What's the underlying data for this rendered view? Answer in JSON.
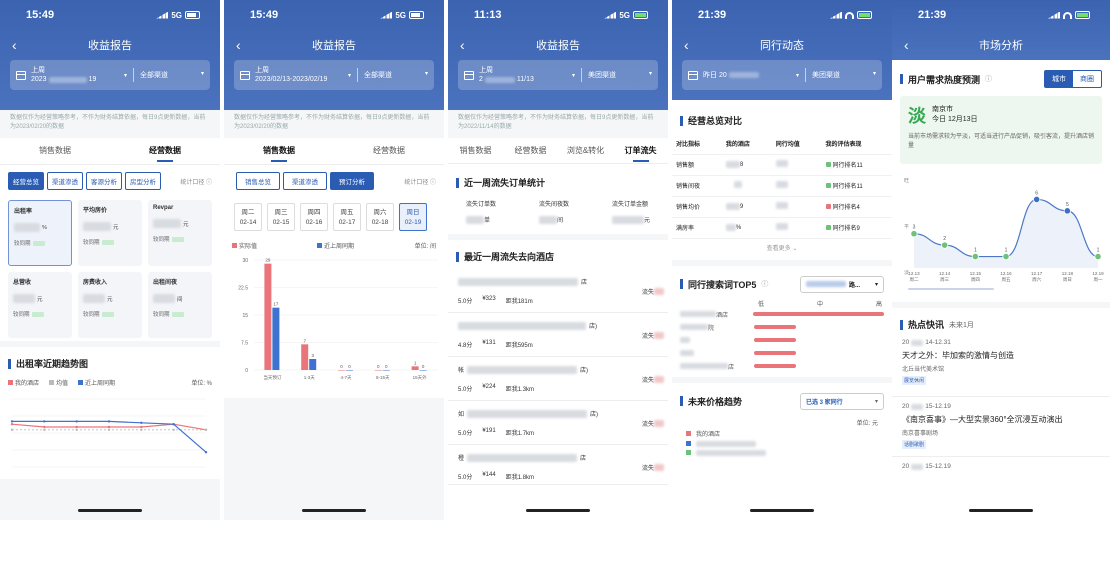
{
  "p1": {
    "time": "15:49",
    "net": "5G",
    "title": "收益报告",
    "date_label": "上周",
    "date_value": "2023",
    "date_end": "19",
    "channel": "全部渠道",
    "note": "数据仅作为经营策略参考，不作为财务结算依据，每日9点更新数据，当前为2023/02/20的数据",
    "tabs": [
      "销售数据",
      "经营数据"
    ],
    "subtabs": [
      "经营总览",
      "渠道渗透",
      "客源分析",
      "房型分析"
    ],
    "stat": "统计口径",
    "kpis": [
      {
        "t": "出租率",
        "u": "%",
        "c": "较同期"
      },
      {
        "t": "平均房价",
        "u": "元",
        "c": "较同期"
      },
      {
        "t": "Revpar",
        "u": "元",
        "c": "较同期"
      },
      {
        "t": "总营收",
        "u": "元",
        "c": "较同期"
      },
      {
        "t": "房费收入",
        "u": "元",
        "c": "较同期"
      },
      {
        "t": "出租间夜",
        "u": "间",
        "c": "较同期"
      }
    ],
    "chart_title": "出租率近期趋势图",
    "legend": [
      "我的酒店",
      "均值",
      "近上周同期"
    ],
    "unit": "单位: %"
  },
  "p2": {
    "time": "15:49",
    "net": "5G",
    "title": "收益报告",
    "date_label": "上周",
    "date_value": "2023/02/13-2023/02/19",
    "channel": "全部渠道",
    "note": "数据仅作为经营策略参考，不作为财务结算依据，每日9点更新数据，当前为2023/02/20的数据",
    "tabs": [
      "销售数据",
      "经营数据"
    ],
    "subtabs": [
      "销售总览",
      "渠道渗透",
      "预订分析"
    ],
    "stat": "统计口径",
    "days": [
      {
        "w": "周二",
        "d": "02-14"
      },
      {
        "w": "周三",
        "d": "02-15"
      },
      {
        "w": "周四",
        "d": "02-16"
      },
      {
        "w": "周五",
        "d": "02-17"
      },
      {
        "w": "周六",
        "d": "02-18"
      },
      {
        "w": "周日",
        "d": "02-19"
      }
    ],
    "legend": [
      "实际值",
      "近上周同期"
    ],
    "unit": "单位: 间"
  },
  "p3": {
    "time": "11:13",
    "net": "5G",
    "title": "收益报告",
    "date_label": "上周",
    "date_value": "2",
    "date_end": "11/13",
    "channel": "美团渠道",
    "note": "数据仅作为经营策略参考，不作为财务结算依据，每日9点更新数据，当前为2022/11/14的数据",
    "tabs": [
      "销售数据",
      "经营数据",
      "浏览&转化",
      "订单流失"
    ],
    "s1": "近一周流失订单统计",
    "lost_labels": [
      "流失订单数",
      "流失间夜数",
      "流失订单金额"
    ],
    "lost_units": [
      "单",
      "间",
      "元"
    ],
    "s2": "最近一周流失去向酒店",
    "hotels": [
      {
        "suffix": "店",
        "score": "5.0分",
        "price": "¥323",
        "dist": "距我181m",
        "lost": "流失"
      },
      {
        "suffix": "店)",
        "score": "4.8分",
        "price": "¥131",
        "dist": "距我595m",
        "lost": "流失"
      },
      {
        "prefix": "帐",
        "suffix": "店)",
        "score": "5.0分",
        "price": "¥224",
        "dist": "距我1.3km",
        "lost": "流失"
      },
      {
        "prefix": "如",
        "suffix": "店)",
        "score": "5.0分",
        "price": "¥191",
        "dist": "距我1.7km",
        "lost": "流失"
      },
      {
        "prefix": "橙",
        "suffix": "店",
        "score": "5.0分",
        "price": "¥144",
        "dist": "距我1.8km",
        "lost": "流失"
      }
    ]
  },
  "p4": {
    "time": "21:39",
    "title": "同行动态",
    "date_label": "昨日 20",
    "channel": "美团渠道",
    "s1": "经营总览对比",
    "cols": [
      "对比指标",
      "我的酒店",
      "同行均值",
      "我的评估表现"
    ],
    "rows": [
      {
        "k": "销售额",
        "my": "8",
        "rank": "同行排名11",
        "c": "#6dc27a"
      },
      {
        "k": "销售间夜",
        "my": "",
        "rank": "同行排名11",
        "c": "#6dc27a"
      },
      {
        "k": "销售均价",
        "my": "9",
        "rank": "同行排名4",
        "c": "#e9747a"
      },
      {
        "k": "满房率",
        "my": "%",
        "rank": "同行排名9",
        "c": "#6dc27a"
      }
    ],
    "more": "查看更多",
    "s2": "同行搜索词TOP5",
    "s2sel": "路...",
    "scale": [
      "低",
      "中",
      "高"
    ],
    "hotel_suffix": [
      "酒店",
      "院",
      "店"
    ],
    "s3": "未来价格趋势",
    "s3sel": "已选 3 家同行",
    "unit": "单位: 元",
    "my_hotel": "我的酒店"
  },
  "p5": {
    "time": "21:39",
    "title": "市场分析",
    "s1": "用户需求热度预测",
    "toggle": [
      "城市",
      "商圈"
    ],
    "level": "淡",
    "city": "南京市",
    "day": "今日 12月13日",
    "desc": "当前市场需求较为平淡，可适当进行产品促销，吸引客流，提升酒店销量",
    "chart": [
      "旺",
      "平",
      "淡"
    ],
    "s2": "热点快讯",
    "s2sub": "未来1月",
    "news": [
      {
        "date_a": "20",
        "date_b": "14-12.31",
        "t": "天才之外：毕加索的激情与创造",
        "p": "北丘当代美术馆",
        "tag": "展览休闲"
      },
      {
        "date_a": "20",
        "date_b": "15-12.19",
        "t": "《南京喜事》—大型实景360°全沉浸互动演出",
        "p": "南京喜事剧场",
        "tag": "话剧歌剧"
      },
      {
        "date_a": "20",
        "date_b": "15-12.19"
      }
    ]
  },
  "chart_data": [
    {
      "type": "line",
      "title": "出租率近期趋势图",
      "series": [
        {
          "name": "我的酒店",
          "values": [
            62,
            60,
            60,
            60,
            60,
            62,
            58
          ]
        },
        {
          "name": "均值",
          "values": [
            58,
            58,
            58,
            58,
            58,
            58,
            58
          ]
        },
        {
          "name": "近上周同期",
          "values": [
            64,
            64,
            64,
            64,
            63,
            62,
            42
          ]
        }
      ]
    },
    {
      "type": "bar",
      "categories": [
        "当天预订",
        "1-3天",
        "4-7天",
        "8-15天",
        "15天外"
      ],
      "yticks": [
        0,
        7.5,
        15,
        22.5,
        30
      ],
      "ylim": [
        0,
        30
      ],
      "series": [
        {
          "name": "实际值",
          "values": [
            29,
            7,
            0,
            0,
            1
          ]
        },
        {
          "name": "近上周同期",
          "values": [
            17,
            3,
            0,
            0,
            0
          ]
        }
      ]
    },
    {
      "type": "line",
      "x": [
        "12.13|周二",
        "12.14|周三",
        "12.15|周四",
        "12.16|周五",
        "12.17|周六",
        "12.18|周日",
        "12.19|周一"
      ],
      "values": [
        3,
        2,
        1,
        1,
        6,
        5,
        1
      ],
      "ylim": [
        0,
        7
      ]
    }
  ]
}
